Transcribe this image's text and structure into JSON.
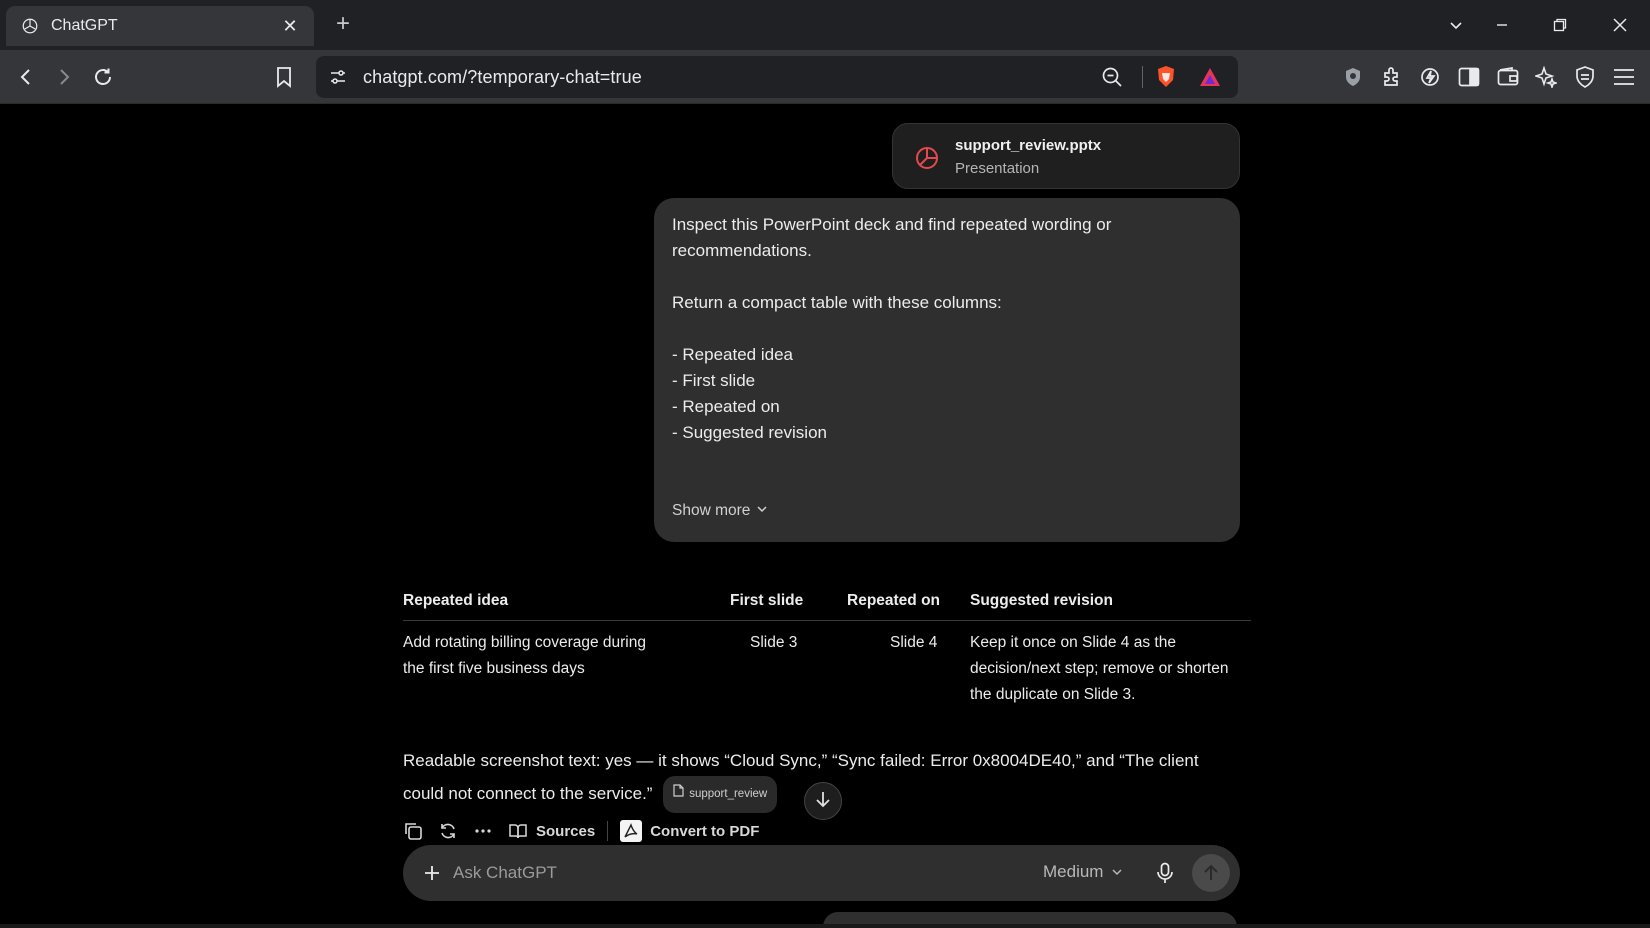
{
  "browser": {
    "tab_title": "ChatGPT",
    "url": "chatgpt.com/?temporary-chat=true",
    "icons": [
      "chatgpt-favicon",
      "close-icon",
      "new-tab-icon",
      "tab-list-icon",
      "minimize-icon",
      "restore-icon",
      "window-close-icon",
      "back-icon",
      "forward-icon",
      "reload-icon",
      "bookmark-icon",
      "site-settings-icon",
      "zoom-icon",
      "brave-shield-icon",
      "brave-rewards-icon",
      "vpn-icon",
      "extensions-icon",
      "leo-icon",
      "sidebar-icon",
      "wallet-icon",
      "ai-icon",
      "shield-icon",
      "menu-icon"
    ]
  },
  "attachment": {
    "name": "support_review.pptx",
    "type": "Presentation",
    "icon": "presentation-icon",
    "accent": "#e5484d"
  },
  "user_message": {
    "line1": "Inspect this PowerPoint deck and find repeated wording or",
    "line2": "recommendations.",
    "line3": "Return a compact table with these columns:",
    "items": [
      "- Repeated idea",
      "- First slide",
      "- Repeated on",
      "- Suggested revision"
    ],
    "show_more": "Show more"
  },
  "table": {
    "headers": [
      "Repeated idea",
      "First slide",
      "Repeated on",
      "Suggested revision"
    ],
    "row": {
      "idea_line1": "Add rotating billing coverage during",
      "idea_line2": "the first five business days",
      "first_slide": "Slide 3",
      "repeated_on": "Slide 4",
      "revision_line1": "Keep it once on Slide 4 as the",
      "revision_line2": "decision/next step; remove or shorten",
      "revision_line3": "the duplicate on Slide 3."
    }
  },
  "summary": {
    "line1": "Readable screenshot text: yes — it shows “Cloud Sync,” “Sync failed: Error 0x8004DE40,” and “The client",
    "line2": "could not connect to the service.”",
    "citation": "support_review"
  },
  "actions": {
    "sources": "Sources",
    "convert": "Convert to PDF"
  },
  "composer": {
    "placeholder": "Ask ChatGPT",
    "model": "Medium"
  }
}
